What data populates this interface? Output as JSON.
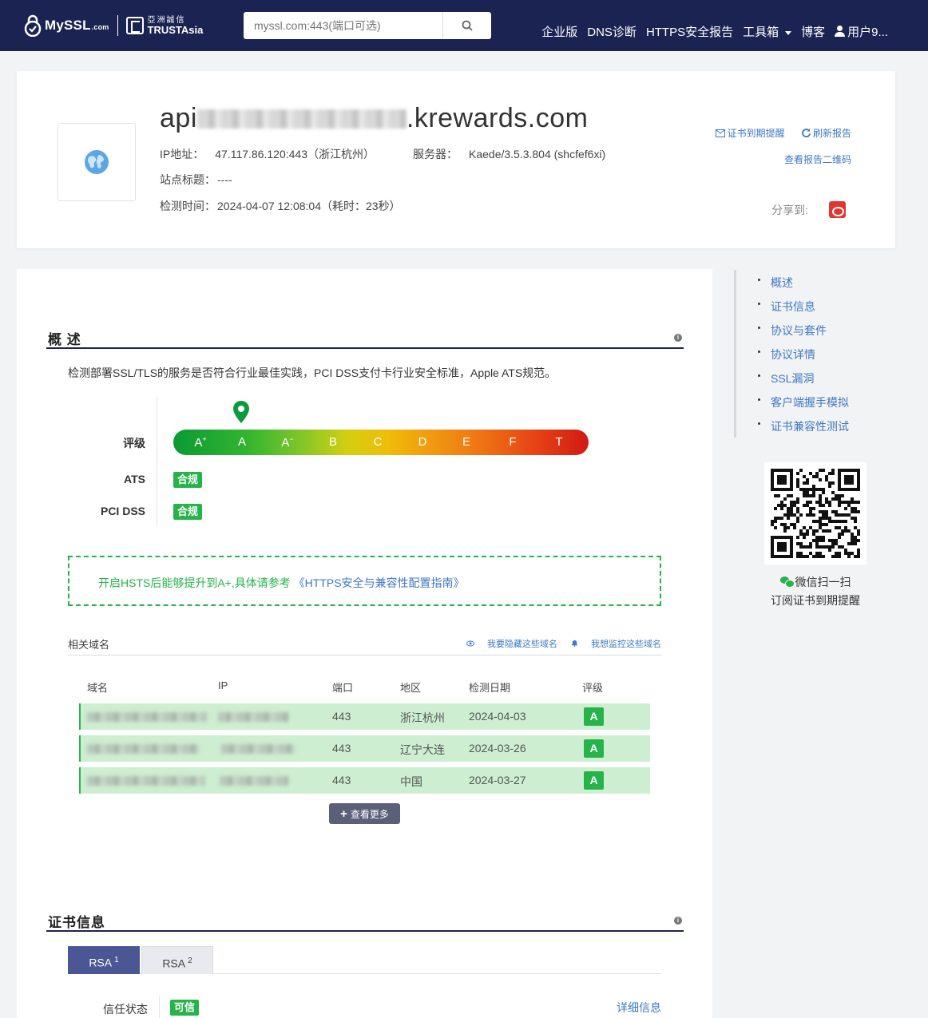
{
  "nav": {
    "logo_text": "MySSL",
    "logo_suffix": ".com",
    "partner_cn": "亞洲誠信",
    "partner_en": "TRUSTAsia",
    "search_placeholder": "myssl.com:443(端口可选)",
    "links": [
      "企业版",
      "DNS诊断",
      "HTTPS安全报告",
      "工具箱",
      "博客"
    ],
    "user": "用户9..."
  },
  "header": {
    "domain_prefix": "api",
    "domain_suffix": ".krewards.com",
    "ip_label": "IP地址：",
    "ip_value": "47.117.86.120:443（浙江杭州）",
    "server_label": "服务器：",
    "server_value": "Kaede/3.5.3.804 (shcfef6xi)",
    "site_title_label": "站点标题：",
    "site_title_value": "----",
    "check_time_label": "检测时间：",
    "check_time_value": "2024-04-07 12:08:04（耗时：23秒）",
    "remind_link": "证书到期提醒",
    "refresh_link": "刷新报告",
    "qr_link": "查看报告二维码",
    "share_label": "分享到:"
  },
  "overview": {
    "title": "概 述",
    "description": "检测部署SSL/TLS的服务是否符合行业最佳实践，PCI DSS支付卡行业安全标准，Apple ATS规范。",
    "rating_label": "评级",
    "current_grade": "A",
    "grades": [
      "A+",
      "A",
      "A-",
      "B",
      "C",
      "D",
      "E",
      "F",
      "T"
    ],
    "ats_label": "ATS",
    "ats_status": "合规",
    "pci_label": "PCI DSS",
    "pci_status": "合规",
    "hsts_notice": "开启HSTS后能够提升到A+,具体请参考",
    "hsts_link": "《HTTPS安全与兼容性配置指南》"
  },
  "related": {
    "title": "相关域名",
    "hide_link": "我要隐藏这些域名",
    "monitor_link": "我想监控这些域名",
    "columns": [
      "域名",
      "IP",
      "端口",
      "地区",
      "检测日期",
      "评级"
    ],
    "rows": [
      {
        "port": "443",
        "region": "浙江杭州",
        "date": "2024-04-03",
        "grade": "A"
      },
      {
        "port": "443",
        "region": "辽宁大连",
        "date": "2024-03-26",
        "grade": "A"
      },
      {
        "port": "443",
        "region": "中国",
        "date": "2024-03-27",
        "grade": "A"
      }
    ],
    "more_button": "查看更多"
  },
  "cert": {
    "title": "证书信息",
    "tab1": "RSA",
    "tab1_sup": "1",
    "tab2": "RSA",
    "tab2_sup": "2",
    "trust_label": "信任状态",
    "trust_value": "可信",
    "detail_link": "详细信息"
  },
  "sidebar": {
    "toc": [
      "概述",
      "证书信息",
      "协议与套件",
      "协议详情",
      "SSL漏洞",
      "客户端握手模拟",
      "证书兼容性测试"
    ],
    "wechat_label": "微信扫一扫",
    "subscribe_text": "订阅证书到期提醒"
  },
  "colors": {
    "navbar": "#1b2352",
    "accent_green": "#25b34a",
    "link_blue": "#3d78c4"
  }
}
